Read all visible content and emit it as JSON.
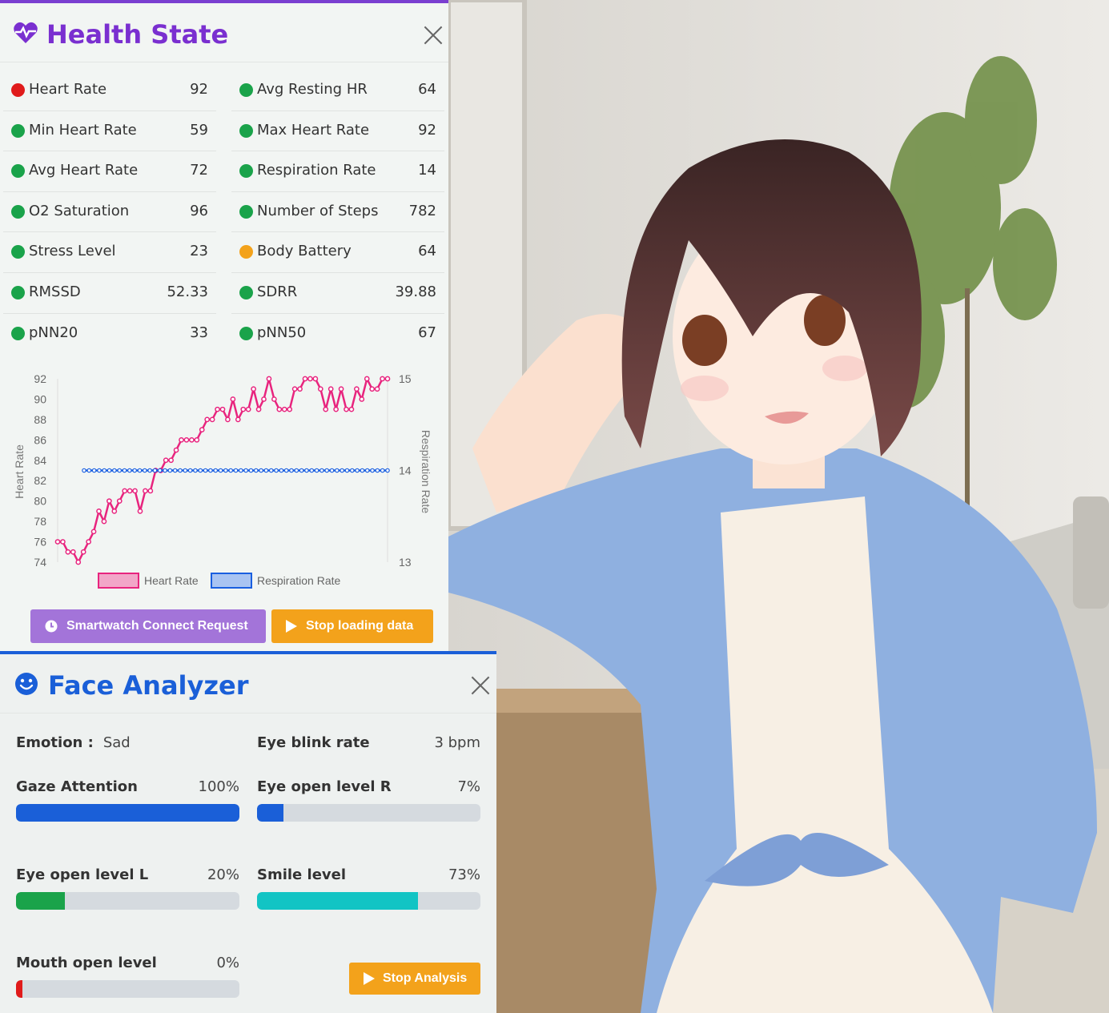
{
  "colors": {
    "health_accent": "#7a2fd0",
    "face_accent": "#1a5fd8",
    "status_red": "#e01b1b",
    "status_green": "#1aa34a",
    "status_orange": "#f3a21b",
    "hr_line": "#e8247e",
    "resp_line": "#1a5fe0"
  },
  "health": {
    "title": "Health State",
    "icon": "heart-pulse-icon",
    "metrics_left": [
      {
        "label": "Heart Rate",
        "value": "92",
        "status": "red"
      },
      {
        "label": "Min Heart Rate",
        "value": "59",
        "status": "green"
      },
      {
        "label": "Avg Heart Rate",
        "value": "72",
        "status": "green"
      },
      {
        "label": "O2 Saturation",
        "value": "96",
        "status": "green"
      },
      {
        "label": "Stress Level",
        "value": "23",
        "status": "green"
      },
      {
        "label": "RMSSD",
        "value": "52.33",
        "status": "green"
      },
      {
        "label": "pNN20",
        "value": "33",
        "status": "green"
      }
    ],
    "metrics_right": [
      {
        "label": "Avg Resting HR",
        "value": "64",
        "status": "green"
      },
      {
        "label": "Max Heart Rate",
        "value": "92",
        "status": "green"
      },
      {
        "label": "Respiration Rate",
        "value": "14",
        "status": "green"
      },
      {
        "label": "Number of Steps",
        "value": "782",
        "status": "green"
      },
      {
        "label": "Body Battery",
        "value": "64",
        "status": "orange"
      },
      {
        "label": "SDRR",
        "value": "39.88",
        "status": "green"
      },
      {
        "label": "pNN50",
        "value": "67",
        "status": "green"
      }
    ],
    "buttons": {
      "connect": "Smartwatch Connect Request",
      "stop_loading": "Stop loading data"
    }
  },
  "chart_data": {
    "type": "line",
    "title": "",
    "y_left_label": "Heart Rate",
    "y_right_label": "Respiration Rate",
    "y_left_ticks": [
      "92",
      "90",
      "88",
      "86",
      "84",
      "82",
      "80",
      "78",
      "76",
      "74"
    ],
    "y_right_ticks": [
      "15",
      "14",
      "13"
    ],
    "y_left_range": [
      74,
      92
    ],
    "y_right_range": [
      13,
      15
    ],
    "legend_position": "bottom",
    "grid": false,
    "series": [
      {
        "name": "Heart Rate",
        "axis": "left",
        "values": [
          76,
          76,
          75,
          75,
          74,
          75,
          76,
          77,
          79,
          78,
          80,
          79,
          80,
          81,
          81,
          81,
          79,
          81,
          81,
          83,
          83,
          84,
          84,
          85,
          86,
          86,
          86,
          86,
          87,
          88,
          88,
          89,
          89,
          88,
          90,
          88,
          89,
          89,
          91,
          89,
          90,
          92,
          90,
          89,
          89,
          89,
          91,
          91,
          92,
          92,
          92,
          91,
          89,
          91,
          89,
          91,
          89,
          89,
          91,
          90,
          92,
          91,
          91,
          92,
          92
        ]
      },
      {
        "name": "Respiration Rate",
        "axis": "right",
        "values": [
          14,
          14,
          14,
          14,
          14,
          14,
          14,
          14,
          14,
          14,
          14,
          14,
          14,
          14,
          14,
          14,
          14,
          14,
          14,
          14,
          14,
          14,
          14,
          14,
          14,
          14,
          14,
          14,
          14,
          14,
          14,
          14,
          14,
          14,
          14,
          14,
          14,
          14,
          14,
          14,
          14,
          14,
          14,
          14,
          14,
          14,
          14,
          14,
          14,
          14,
          14,
          14,
          14,
          14,
          14,
          14,
          14,
          14,
          14,
          14,
          14
        ]
      }
    ]
  },
  "face": {
    "title": "Face Analyzer",
    "icon": "smiley-face-icon",
    "emotion_label": "Emotion :",
    "emotion_value": "Sad",
    "blink_label": "Eye blink rate",
    "blink_value": "3 bpm",
    "bars": [
      {
        "label": "Gaze Attention",
        "value": "100%",
        "level": 1.0,
        "color": "#1a5fd8"
      },
      {
        "label": "Eye open level R",
        "value": "7%",
        "level": 0.12,
        "color": "#1a5fd8"
      },
      {
        "label": "Eye open level L",
        "value": "20%",
        "level": 0.22,
        "color": "#1aa34a"
      },
      {
        "label": "Smile level",
        "value": "73%",
        "level": 0.72,
        "color": "#12c4c4"
      },
      {
        "label": "Mouth open level",
        "value": "0%",
        "level": 0.03,
        "color": "#e01b1b"
      }
    ],
    "stop_button": "Stop Analysis"
  }
}
